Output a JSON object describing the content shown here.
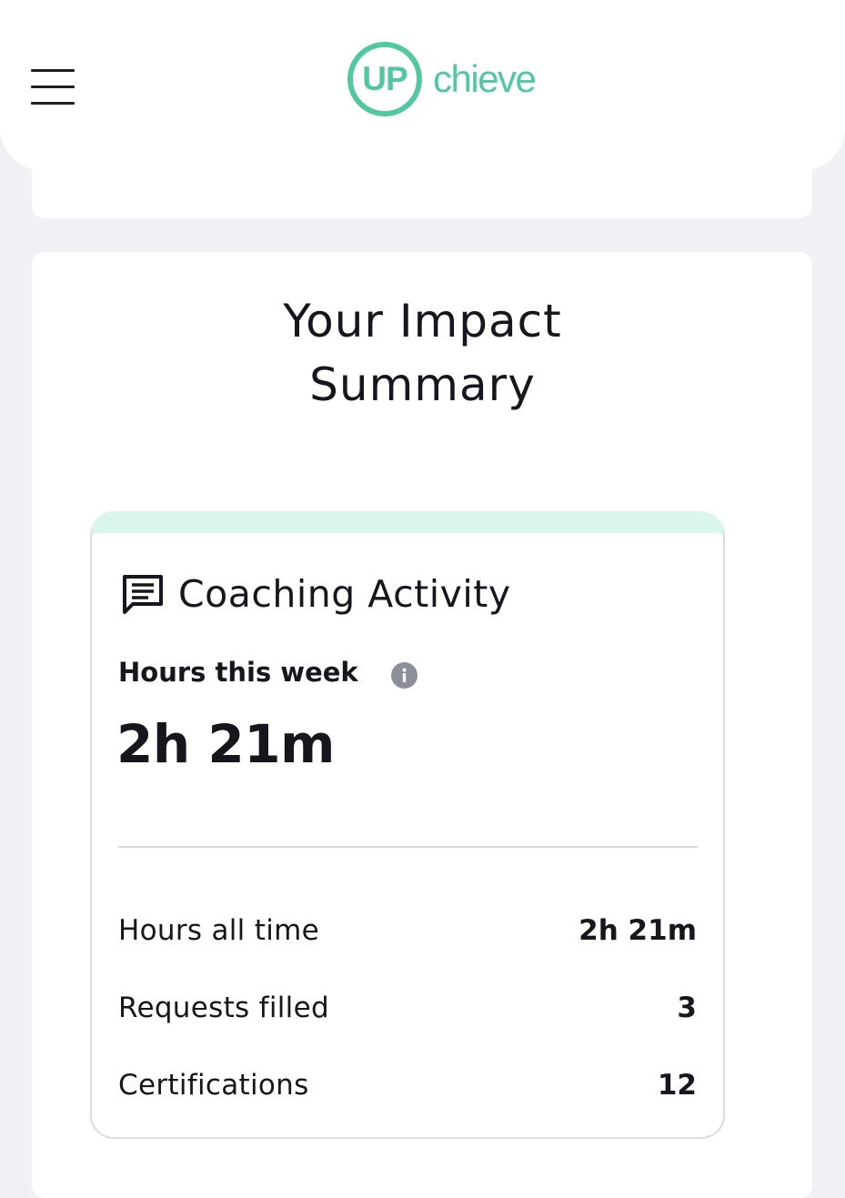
{
  "header": {
    "logo": {
      "mark_text": "UP",
      "word_text": "chieve",
      "brand_color": "#52c8a0"
    },
    "menu_icon": "hamburger-menu-icon"
  },
  "impact_summary": {
    "title_line1": "Your Impact",
    "title_line2": "Summary"
  },
  "coaching_activity": {
    "icon": "chat-message-icon",
    "heading": "Coaching Activity",
    "accent_color": "#daf4ee",
    "hours_this_week": {
      "label": "Hours this week",
      "info_icon": "info-icon",
      "value": "2h 21m"
    },
    "stats": [
      {
        "label": "Hours all time",
        "value": "2h 21m"
      },
      {
        "label": "Requests filled",
        "value": "3"
      },
      {
        "label": "Certifications",
        "value": "12"
      }
    ]
  }
}
